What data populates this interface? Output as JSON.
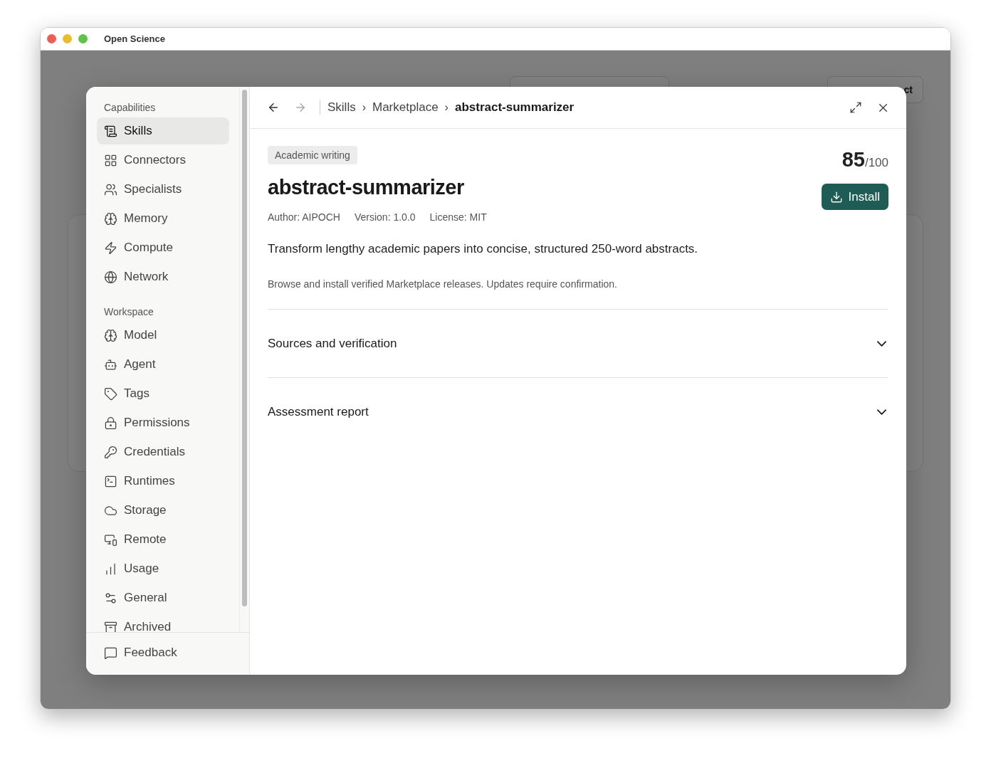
{
  "window": {
    "title": "Open Science"
  },
  "background": {
    "button_label": "ct"
  },
  "sidebar": {
    "sections": [
      {
        "heading": "Capabilities",
        "items": [
          {
            "label": "Skills",
            "selected": true
          },
          {
            "label": "Connectors",
            "selected": false
          },
          {
            "label": "Specialists",
            "selected": false
          },
          {
            "label": "Memory",
            "selected": false
          },
          {
            "label": "Compute",
            "selected": false
          },
          {
            "label": "Network",
            "selected": false
          }
        ]
      },
      {
        "heading": "Workspace",
        "items": [
          {
            "label": "Model",
            "selected": false
          },
          {
            "label": "Agent",
            "selected": false
          },
          {
            "label": "Tags",
            "selected": false
          },
          {
            "label": "Permissions",
            "selected": false
          },
          {
            "label": "Credentials",
            "selected": false
          },
          {
            "label": "Runtimes",
            "selected": false
          },
          {
            "label": "Storage",
            "selected": false
          },
          {
            "label": "Remote",
            "selected": false
          },
          {
            "label": "Usage",
            "selected": false
          },
          {
            "label": "General",
            "selected": false
          },
          {
            "label": "Archived",
            "selected": false
          }
        ]
      }
    ],
    "footer": {
      "label": "Feedback"
    }
  },
  "header": {
    "back_disabled": false,
    "forward_disabled": true,
    "separator": "›",
    "breadcrumb": [
      "Skills",
      "Marketplace",
      "abstract-summarizer"
    ]
  },
  "detail": {
    "tag": "Academic writing",
    "title": "abstract-summarizer",
    "score": "85",
    "score_max": "/100",
    "install": "Install",
    "meta": [
      "Author: AIPOCH",
      "Version: 1.0.0",
      "License: MIT"
    ],
    "description": "Transform lengthy academic papers into concise, structured 250-word abstracts.",
    "note": "Browse and install verified Marketplace releases. Updates require confirmation."
  },
  "sections": [
    {
      "title": "Sources and verification",
      "expanded": false
    },
    {
      "title": "Assessment report",
      "expanded": false
    }
  ]
}
